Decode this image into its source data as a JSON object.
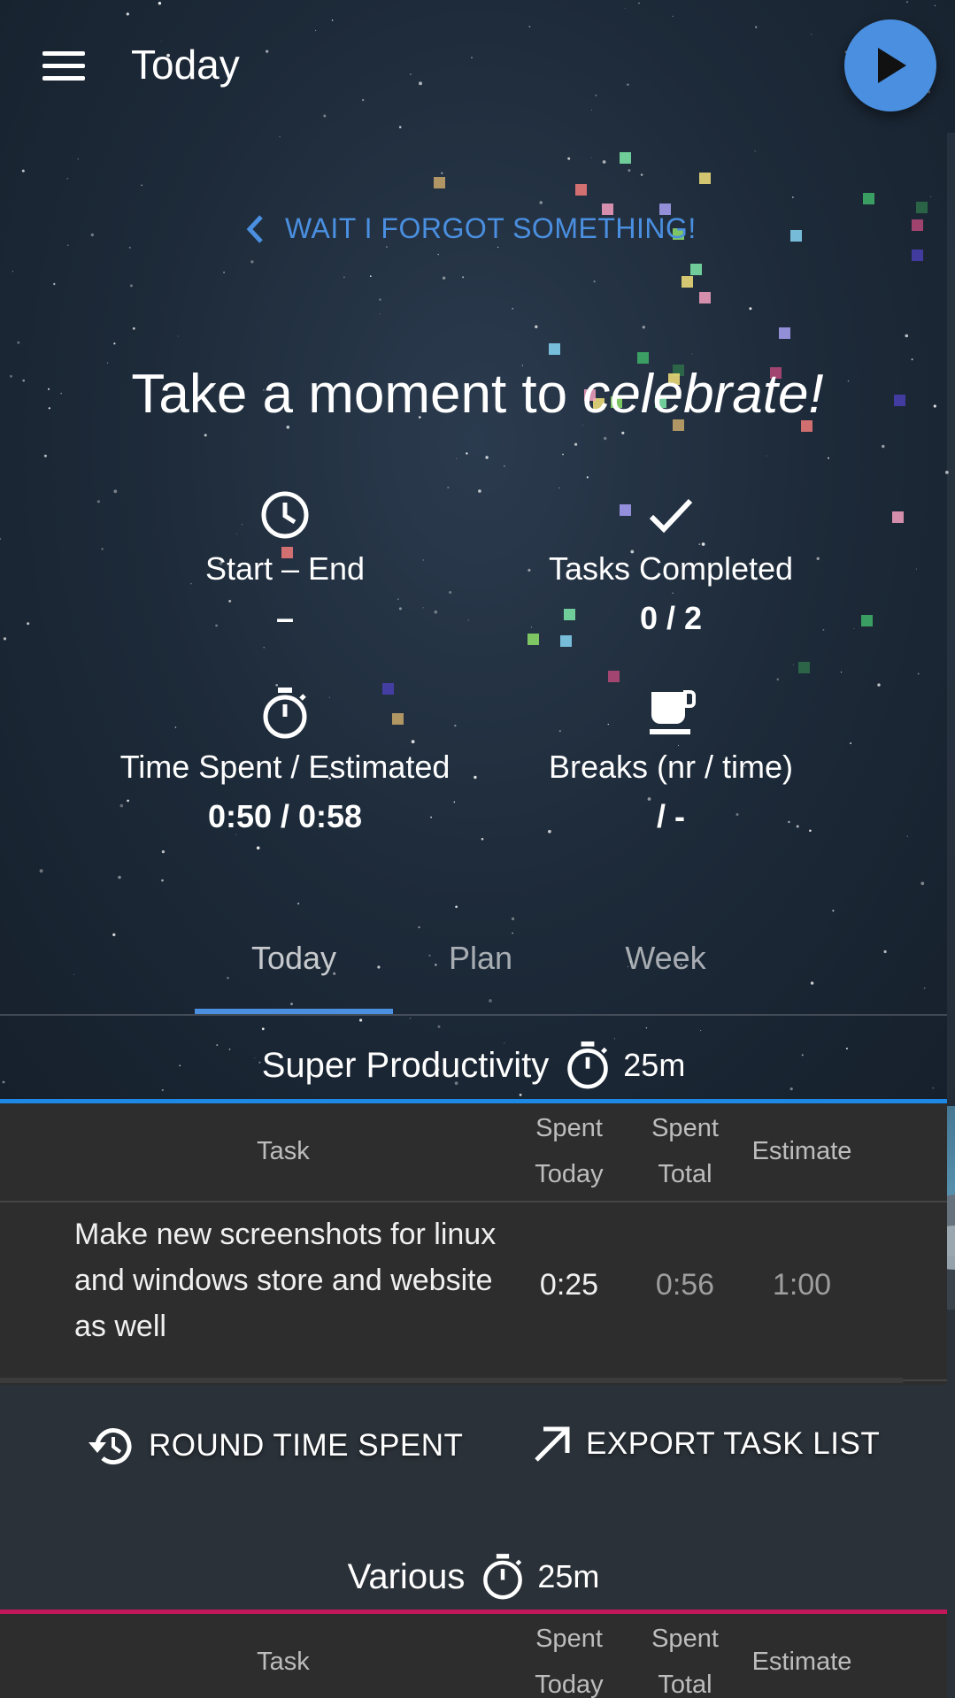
{
  "header": {
    "title": "Today",
    "menu_icon": "menu-icon",
    "play_icon": "play-icon"
  },
  "back_link": {
    "label": "WAIT I FORGOT SOMETHING!",
    "icon": "chevron-left-icon"
  },
  "celebrate": {
    "prefix": "Take a moment to ",
    "emphasis": "celebrate!"
  },
  "stats": {
    "start_end": {
      "icon": "clock-icon",
      "label": "Start – End",
      "value": "–"
    },
    "tasks_completed": {
      "icon": "check-icon",
      "label": "Tasks Completed",
      "value": "0 / 2"
    },
    "time_spent": {
      "icon": "timer-icon",
      "label": "Time Spent / Estimated",
      "value": "0:50 / 0:58"
    },
    "breaks": {
      "icon": "coffee-icon",
      "label": "Breaks (nr / time)",
      "value": " / -"
    }
  },
  "tabs": [
    {
      "label": "Today",
      "active": true
    },
    {
      "label": "Plan",
      "active": false
    },
    {
      "label": "Week",
      "active": false
    }
  ],
  "projects": [
    {
      "name": "Super Productivity",
      "time": "25m",
      "color": "#1e88e5",
      "columns": {
        "task": "Task",
        "spent_today": [
          "Spent",
          "Today"
        ],
        "spent_total": [
          "Spent",
          "Total"
        ],
        "estimate": "Estimate"
      },
      "rows": [
        {
          "title": "Make new screenshots for linux and windows store and website as well",
          "spent_today": "0:25",
          "spent_total": "0:56",
          "estimate": "1:00"
        }
      ]
    },
    {
      "name": "Various",
      "time": "25m",
      "color": "#c2185b",
      "columns": {
        "task": "Task",
        "spent_today": [
          "Spent",
          "Today"
        ],
        "spent_total": [
          "Spent",
          "Total"
        ],
        "estimate": "Estimate"
      },
      "rows": []
    }
  ],
  "actions": {
    "round_time": {
      "label": "ROUND TIME SPENT",
      "icon": "history-icon"
    },
    "export": {
      "label": "EXPORT TASK LIST",
      "icon": "arrow-up-right-icon"
    }
  },
  "colors": {
    "accent": "#4a8fe0",
    "table_bg": "#2d2d2d",
    "project1_bar": "#1e88e5",
    "project2_bar": "#c2185b"
  }
}
